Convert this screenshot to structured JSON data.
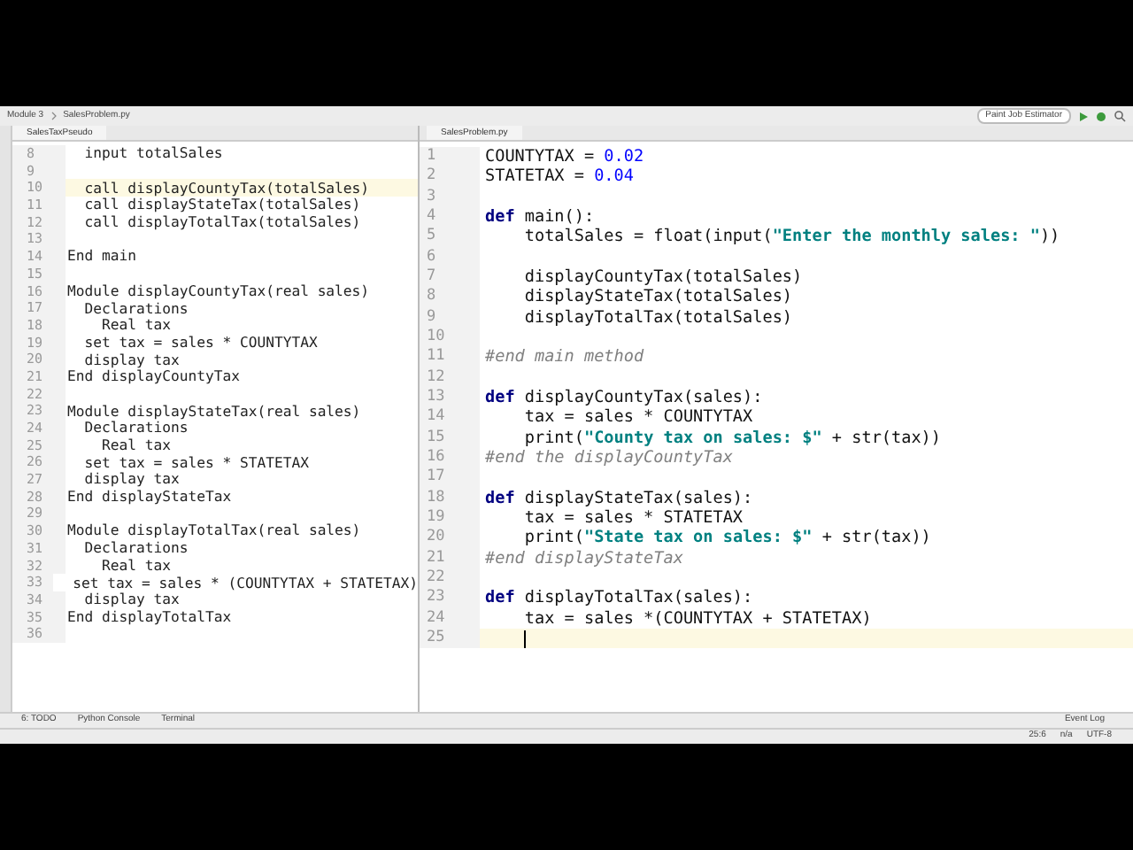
{
  "breadcrumb": [
    {
      "label": "Module 3"
    },
    {
      "label": "SalesProblem.py"
    }
  ],
  "run_config": {
    "label": "Paint Job Estimator"
  },
  "left_editor": {
    "tab": {
      "label": "SalesTaxPseudo"
    },
    "lines": [
      {
        "number": "8",
        "text": "  input totalSales",
        "current": false
      },
      {
        "number": "9",
        "current": false
      },
      {
        "number": "10",
        "text": "  call displayCountyTax(totalSales)",
        "current": true
      },
      {
        "number": "11",
        "text": "  call displayStateTax(totalSales)",
        "current": false
      },
      {
        "number": "12",
        "text": "  call displayTotalTax(totalSales)",
        "current": false
      },
      {
        "number": "13",
        "current": false
      },
      {
        "number": "14",
        "text": "End main",
        "current": false
      },
      {
        "number": "15",
        "current": false
      },
      {
        "number": "16",
        "text": "Module displayCountyTax(real sales)",
        "current": false
      },
      {
        "number": "17",
        "text": "  Declarations",
        "current": false
      },
      {
        "number": "18",
        "text": "    Real tax",
        "current": false
      },
      {
        "number": "19",
        "text": "  set tax = sales * COUNTYTAX",
        "current": false
      },
      {
        "number": "20",
        "text": "  display tax",
        "current": false
      },
      {
        "number": "21",
        "text": "End displayCountyTax",
        "current": false
      },
      {
        "number": "22",
        "current": false
      },
      {
        "number": "23",
        "text": "Module displayStateTax(real sales)",
        "current": false
      },
      {
        "number": "24",
        "text": "  Declarations",
        "current": false
      },
      {
        "number": "25",
        "text": "    Real tax",
        "current": false
      },
      {
        "number": "26",
        "text": "  set tax = sales * STATETAX",
        "current": false
      },
      {
        "number": "27",
        "text": "  display tax",
        "current": false
      },
      {
        "number": "28",
        "text": "End displayStateTax",
        "current": false
      },
      {
        "number": "29",
        "current": false
      },
      {
        "number": "30",
        "text": "Module displayTotalTax(real sales)",
        "current": false
      },
      {
        "number": "31",
        "text": "  Declarations",
        "current": false
      },
      {
        "number": "32",
        "text": "    Real tax",
        "current": false
      },
      {
        "number": "33",
        "text": "  set tax = sales * (COUNTYTAX + STATETAX)",
        "current": false
      },
      {
        "number": "34",
        "text": "  display tax",
        "current": false
      },
      {
        "number": "35",
        "text": "End displayTotalTax",
        "current": false
      },
      {
        "number": "36",
        "current": false
      }
    ]
  },
  "right_editor": {
    "tab": {
      "label": "SalesProblem.py"
    },
    "lines": [
      {
        "number": "1",
        "current": false,
        "segments": [
          {
            "kind": "plain",
            "text": "COUNTYTAX = "
          },
          {
            "kind": "number",
            "text": "0.02"
          }
        ]
      },
      {
        "number": "2",
        "current": false,
        "segments": [
          {
            "kind": "plain",
            "text": "STATETAX = "
          },
          {
            "kind": "number",
            "text": "0.04"
          }
        ]
      },
      {
        "number": "3",
        "current": false
      },
      {
        "number": "4",
        "current": false,
        "segments": [
          {
            "kind": "keyword",
            "text": "def"
          },
          {
            "kind": "plain",
            "text": " main():"
          }
        ]
      },
      {
        "number": "5",
        "current": false,
        "segments": [
          {
            "kind": "plain",
            "text": "    totalSales = float(input("
          },
          {
            "kind": "string",
            "text": "\"Enter the monthly sales: \""
          },
          {
            "kind": "plain",
            "text": "))"
          }
        ]
      },
      {
        "number": "6",
        "current": false
      },
      {
        "number": "7",
        "current": false,
        "segments": [
          {
            "kind": "plain",
            "text": "    displayCountyTax(totalSales)"
          }
        ]
      },
      {
        "number": "8",
        "current": false,
        "segments": [
          {
            "kind": "plain",
            "text": "    displayStateTax(totalSales)"
          }
        ]
      },
      {
        "number": "9",
        "current": false,
        "segments": [
          {
            "kind": "plain",
            "text": "    displayTotalTax(totalSales)"
          }
        ]
      },
      {
        "number": "10",
        "current": false
      },
      {
        "number": "11",
        "current": false,
        "segments": [
          {
            "kind": "comment",
            "text": "#end main method"
          }
        ]
      },
      {
        "number": "12",
        "current": false
      },
      {
        "number": "13",
        "current": false,
        "segments": [
          {
            "kind": "keyword",
            "text": "def"
          },
          {
            "kind": "plain",
            "text": " displayCountyTax(sales):"
          }
        ]
      },
      {
        "number": "14",
        "current": false,
        "segments": [
          {
            "kind": "plain",
            "text": "    tax = sales * COUNTYTAX"
          }
        ]
      },
      {
        "number": "15",
        "current": false,
        "segments": [
          {
            "kind": "plain",
            "text": "    print("
          },
          {
            "kind": "string",
            "text": "\"County tax on sales: $\""
          },
          {
            "kind": "plain",
            "text": " + str(tax))"
          }
        ]
      },
      {
        "number": "16",
        "current": false,
        "segments": [
          {
            "kind": "comment",
            "text": "#end the displayCountyTax"
          }
        ]
      },
      {
        "number": "17",
        "current": false
      },
      {
        "number": "18",
        "current": false,
        "segments": [
          {
            "kind": "keyword",
            "text": "def"
          },
          {
            "kind": "plain",
            "text": " displayStateTax(sales):"
          }
        ]
      },
      {
        "number": "19",
        "current": false,
        "segments": [
          {
            "kind": "plain",
            "text": "    tax = sales * STATETAX"
          }
        ]
      },
      {
        "number": "20",
        "current": false,
        "segments": [
          {
            "kind": "plain",
            "text": "    print("
          },
          {
            "kind": "string",
            "text": "\"State tax on sales: $\""
          },
          {
            "kind": "plain",
            "text": " + str(tax))"
          }
        ]
      },
      {
        "number": "21",
        "current": false,
        "segments": [
          {
            "kind": "comment",
            "text": "#end displayStateTax"
          }
        ]
      },
      {
        "number": "22",
        "current": false
      },
      {
        "number": "23",
        "current": false,
        "segments": [
          {
            "kind": "keyword",
            "text": "def"
          },
          {
            "kind": "plain",
            "text": " displayTotalTax(sales):"
          }
        ]
      },
      {
        "number": "24",
        "current": false,
        "segments": [
          {
            "kind": "plain",
            "text": "    tax = sales *(COUNTYTAX + STATETAX)"
          }
        ]
      },
      {
        "number": "25",
        "current": true
      }
    ]
  },
  "tool_windows": [
    {
      "label": "6: TODO"
    },
    {
      "label": "Python Console"
    },
    {
      "label": "Terminal"
    }
  ],
  "event_log": {
    "label": "Event Log"
  },
  "status": [
    "25:6",
    "n/a",
    "UTF-8"
  ]
}
